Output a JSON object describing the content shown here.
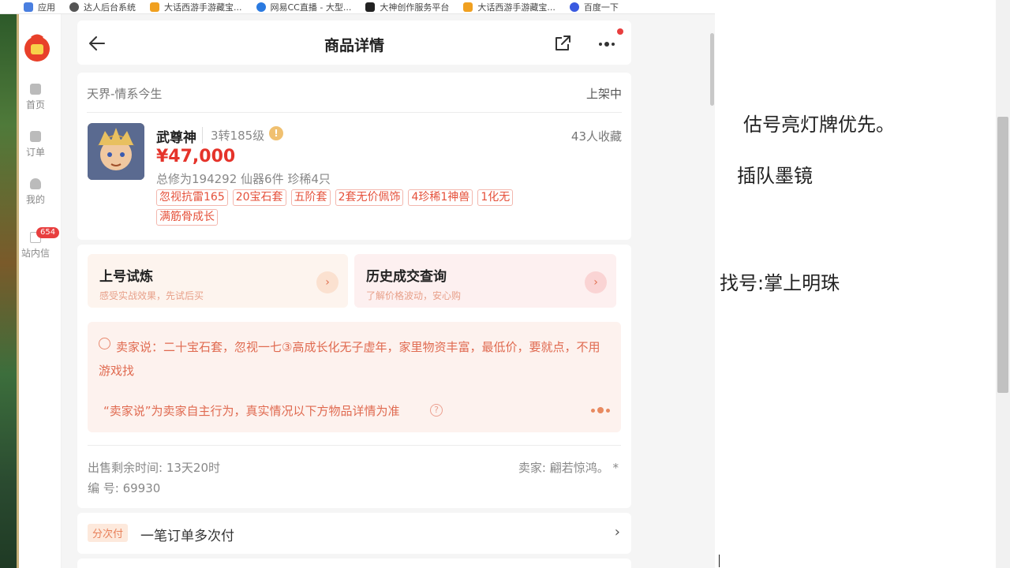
{
  "bookmarks": [
    {
      "label": "应用",
      "icon": "apps-icon",
      "color": "#4a7fe0"
    },
    {
      "label": "达人后台系统",
      "icon": "globe-icon",
      "color": "#555555"
    },
    {
      "label": "大话西游手游藏宝...",
      "icon": "treasure-icon",
      "color": "#f0a020"
    },
    {
      "label": "网易CC直播 - 大型...",
      "icon": "cc-live-icon",
      "color": "#2a7ae0"
    },
    {
      "label": "大神创作服务平台",
      "icon": "dashen-icon",
      "color": "#222222"
    },
    {
      "label": "大话西游手游藏宝...",
      "icon": "treasure-icon",
      "color": "#f0a020"
    },
    {
      "label": "百度一下",
      "icon": "baidu-icon",
      "color": "#3a5ae0"
    }
  ],
  "sidebar": {
    "items": [
      {
        "label": "首页",
        "icon": "home-icon"
      },
      {
        "label": "订单",
        "icon": "order-icon"
      },
      {
        "label": "我的",
        "icon": "user-icon"
      },
      {
        "label": "站内信",
        "icon": "mail-icon",
        "badge": "654"
      }
    ]
  },
  "header": {
    "title": "商品详情"
  },
  "product": {
    "server": "天界-情系今生",
    "status": "上架中",
    "name": "武尊神",
    "level": "3转185级",
    "favorites": "43人收藏",
    "price": "¥47,000",
    "stats": "总修为194292 仙器6件 珍稀4只",
    "tags": [
      "忽视抗雷165",
      "20宝石套",
      "五阶套",
      "2套无价佩饰",
      "4珍稀1神兽",
      "1化无",
      "满筋骨成长"
    ]
  },
  "promos": [
    {
      "title": "上号试炼",
      "subtitle": "感受实战效果，先试后买"
    },
    {
      "title": "历史成交查询",
      "subtitle": "了解价格波动，安心购"
    }
  ],
  "seller_says": {
    "text": "卖家说：二十宝石套，忽视一七③高成长化无子虚年，家里物资丰富，最低价，要就点，不用游戏找",
    "note": "“卖家说”为卖家自主行为，真实情况以下方物品详情为准"
  },
  "meta": {
    "remaining": "出售剩余时间: 13天20时",
    "seller": "卖家: 翩若惊鸿。 *",
    "serial": "编 号: 69930"
  },
  "installment": {
    "tag": "分次付",
    "text": "一笔订单多次付"
  },
  "notes": {
    "line1": "估号亮灯牌优先。",
    "line2": "插队墨镜",
    "line3": "找号:掌上明珠"
  },
  "colors": {
    "price": "#e5332a",
    "accent": "#e06a50",
    "badge": "#e83e3e"
  }
}
